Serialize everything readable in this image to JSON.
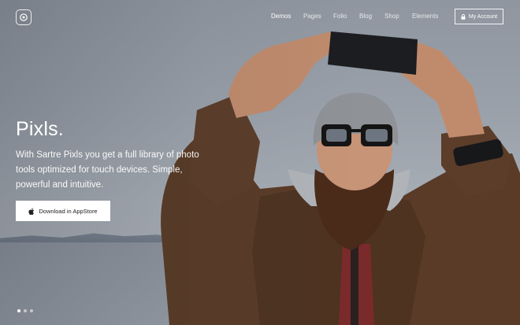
{
  "nav": {
    "items": [
      {
        "label": "Demos",
        "active": true
      },
      {
        "label": "Pages",
        "active": false
      },
      {
        "label": "Folio",
        "active": false
      },
      {
        "label": "Blog",
        "active": false
      },
      {
        "label": "Shop",
        "active": false
      },
      {
        "label": "Elements",
        "active": false
      }
    ],
    "account_label": "My Account"
  },
  "hero": {
    "title": "Pixls.",
    "subtitle": "With Sartre Pixls you get a full library of photo tools optimized for touch devices. Simple, powerful and intuitive.",
    "cta_label": "Download in AppStore"
  },
  "slider": {
    "count": 3,
    "active_index": 0
  },
  "colors": {
    "accent": "#ffffff",
    "cta_text": "#222222"
  },
  "icons": {
    "logo": "logo-icon",
    "lock": "lock-icon",
    "apple": "apple-icon"
  }
}
